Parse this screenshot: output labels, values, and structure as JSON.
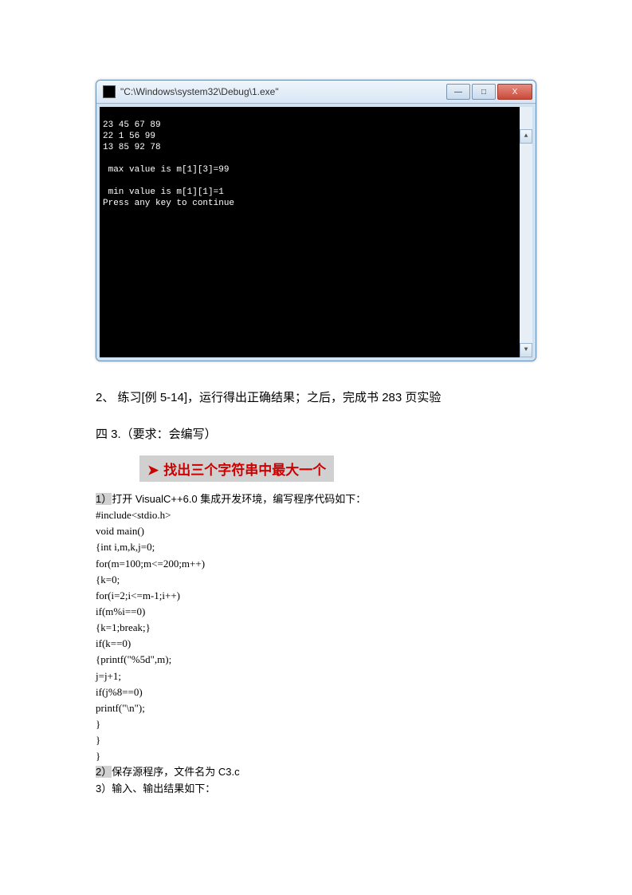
{
  "console": {
    "title": "\"C:\\Windows\\system32\\Debug\\1.exe\"",
    "lines": [
      "23 45 67 89",
      "22 1 56 99",
      "13 85 92 78",
      "",
      " max value is m[1][3]=99",
      "",
      " min value is m[1][1]=1",
      "Press any key to continue"
    ],
    "btn_min": "—",
    "btn_max": "□",
    "btn_close": "X",
    "sb_up": "▲",
    "sb_down": "▼"
  },
  "doc": {
    "line1": "2、 练习[例 5-14]，运行得出正确结果；之后，完成书 283 页实验",
    "line2": "四 3.（要求：会编写）",
    "highlight_arrow": "➤",
    "highlight_text": "找出三个字符串中最大一个",
    "step1_num": "1）",
    "step1_text": "打开 VisualC++6.0 集成开发环境，编写程序代码如下：",
    "code": [
      "#include<stdio.h>",
      "void main()",
      "{int i,m,k,j=0;",
      "for(m=100;m<=200;m++)",
      "{k=0;",
      "for(i=2;i<=m-1;i++)",
      "if(m%i==0)",
      "{k=1;break;}",
      "if(k==0)",
      "{printf(\"%5d\",m);",
      "j=j+1;",
      "if(j%8==0)",
      "printf(\"\\n\");",
      "}",
      "}",
      "}"
    ],
    "step2_num": "2）",
    "step2_text": "保存源程序，文件名为 C3.c",
    "step3_num": "3）",
    "step3_text": "输入、输出结果如下："
  }
}
